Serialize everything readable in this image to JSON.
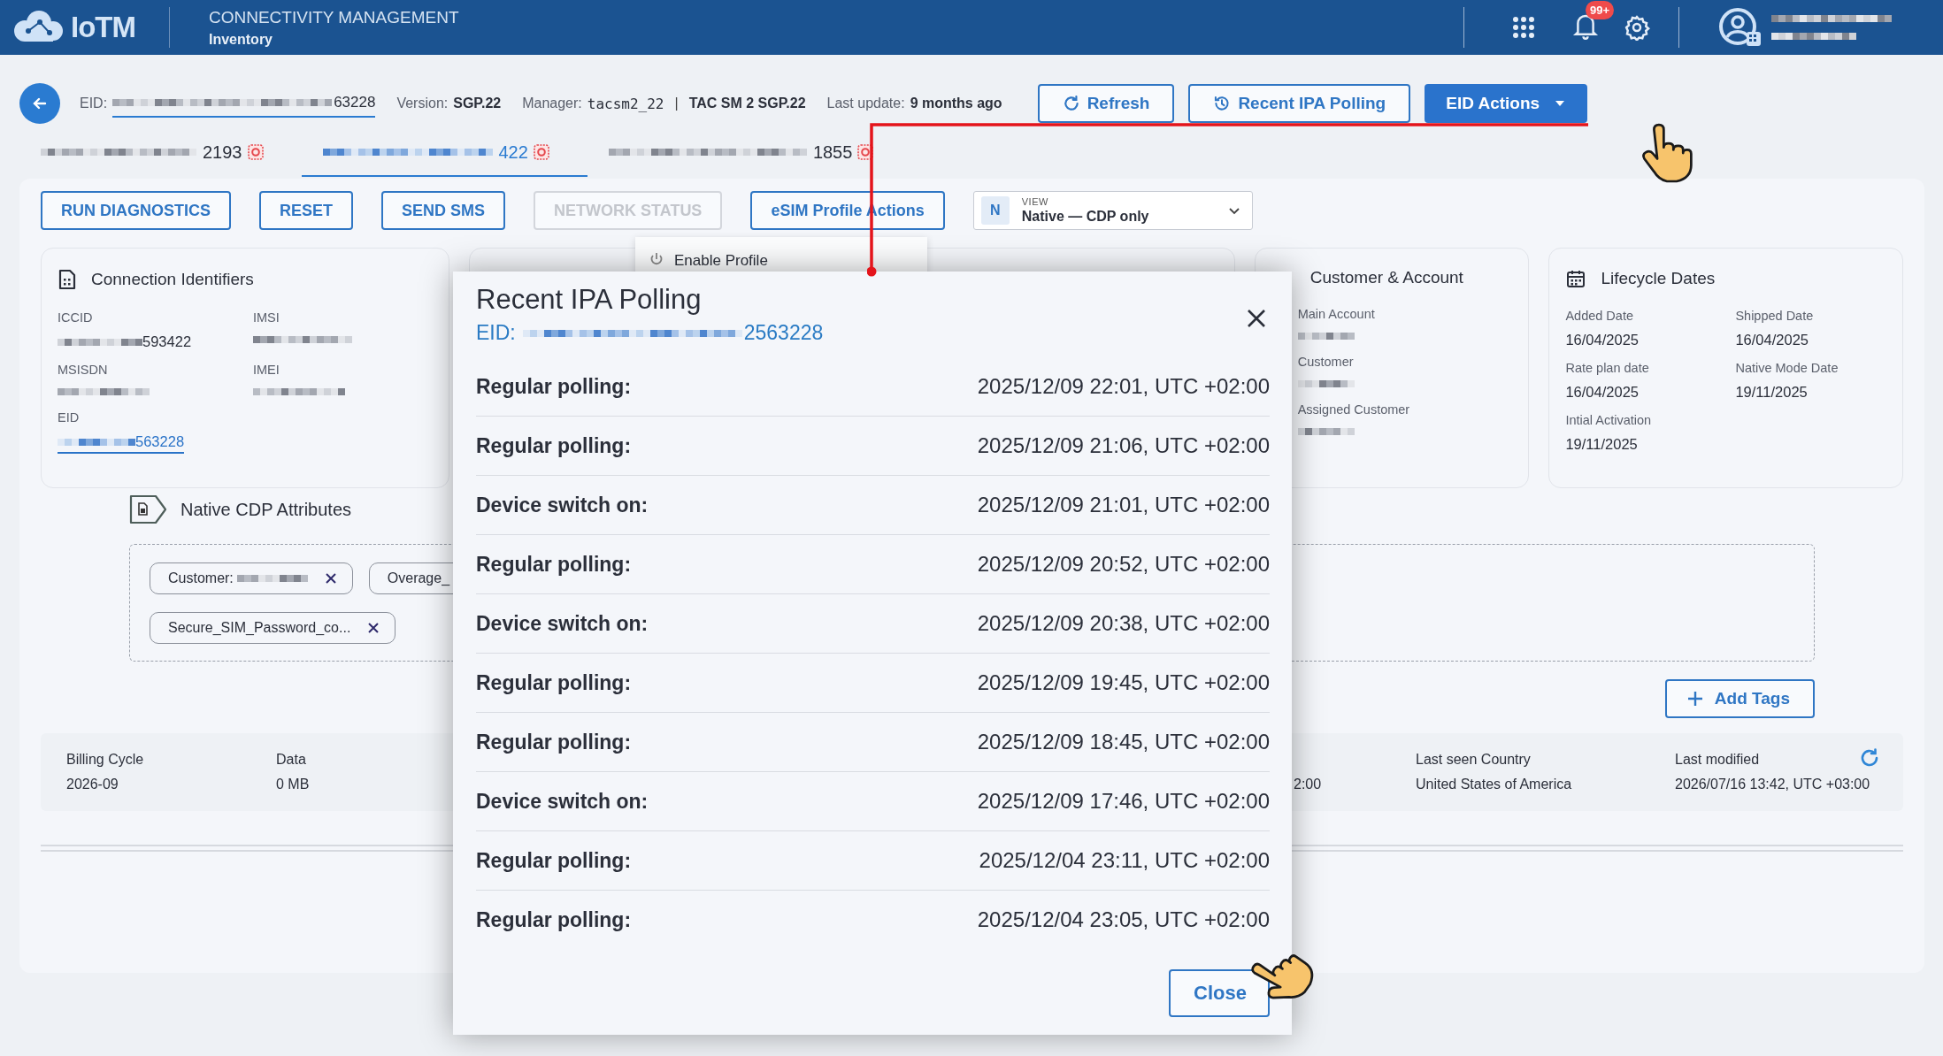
{
  "header": {
    "logo": "IoTM",
    "title": "CONNECTIVITY MANAGEMENT",
    "subtitle": "Inventory",
    "notification_badge": "99+"
  },
  "device": {
    "eid_label": "EID:",
    "eid_visible": "63228",
    "version_label": "Version:",
    "version": "SGP.22",
    "manager_label": "Manager:",
    "manager": "tacsm2_22",
    "separator": "|",
    "manager_name": "TAC SM 2 SGP.22",
    "update_label": "Last update:",
    "update": "9 months ago"
  },
  "header_buttons": [
    {
      "label": "Refresh",
      "kind": "refresh"
    },
    {
      "label": "Recent IPA Polling",
      "kind": "history"
    },
    {
      "label": "EID Actions",
      "kind": "menu"
    }
  ],
  "profile_tabs": [
    {
      "label": "2193",
      "selected": false
    },
    {
      "label": "422",
      "selected": true
    },
    {
      "label": "1855",
      "selected": false
    }
  ],
  "actions": [
    {
      "label": "RUN DIAGNOSTICS",
      "disabled": false
    },
    {
      "label": "RESET",
      "disabled": false
    },
    {
      "label": "SEND SMS",
      "disabled": false
    },
    {
      "label": "NETWORK STATUS",
      "disabled": true
    },
    {
      "label": "eSIM Profile Actions",
      "disabled": false
    }
  ],
  "view_select": {
    "badge": "N",
    "label": "VIEW",
    "value": "Native — CDP only"
  },
  "profile_menu": {
    "items": [
      "Enable Profile"
    ]
  },
  "connection_identifiers": {
    "title": "Connection Identifiers",
    "fields": [
      {
        "label": "ICCID",
        "value": "593422"
      },
      {
        "label": "IMSI"
      },
      {
        "label": "MSISDN"
      },
      {
        "label": "IMEI"
      },
      {
        "label": "EID",
        "value": "563228",
        "kind": "link"
      }
    ]
  },
  "customer_account": {
    "title": "Customer & Account",
    "fields": [
      {
        "label": "Main Account"
      },
      {
        "label": "Customer"
      },
      {
        "label": "Assigned Customer"
      }
    ]
  },
  "lifecycle": {
    "title": "Lifecycle Dates",
    "fields": [
      {
        "label": "Added Date",
        "value": "16/04/2025"
      },
      {
        "label": "Shipped Date",
        "value": "16/04/2025"
      },
      {
        "label": "Rate plan date",
        "value": "16/04/2025"
      },
      {
        "label": "Native Mode Date",
        "value": "19/11/2025"
      },
      {
        "label": "Intial Activation",
        "value": "19/11/2025"
      }
    ]
  },
  "cdp": {
    "title": "Native CDP Attributes",
    "tag_rows": [
      [
        {
          "label": "Customer:",
          "masked": true,
          "removable": true
        },
        {
          "label": "Overage_",
          "masked": false,
          "removable": false
        }
      ],
      [
        {
          "label": "Secure_SIM_Password_co...",
          "masked": false,
          "removable": true
        }
      ]
    ],
    "add_button": "Add Tags"
  },
  "summary": [
    {
      "label": "Billing Cycle",
      "value": "2026-09"
    },
    {
      "label": "Data",
      "value": "0 MB"
    },
    {
      "value": "2:00"
    },
    {
      "label": "Last seen Country",
      "value": "United States of America"
    },
    {
      "label": "Last modified",
      "value": "2026/07/16 13:42, UTC +03:00"
    }
  ],
  "modal": {
    "title": "Recent IPA Polling",
    "eid_label": "EID:",
    "eid_visible": "2563228",
    "close": "Close",
    "events": [
      {
        "label": "Regular polling:",
        "time": "2025/12/09 22:01, UTC +02:00"
      },
      {
        "label": "Regular polling:",
        "time": "2025/12/09 21:06, UTC +02:00"
      },
      {
        "label": "Device switch on:",
        "time": "2025/12/09 21:01, UTC +02:00"
      },
      {
        "label": "Regular polling:",
        "time": "2025/12/09 20:52, UTC +02:00"
      },
      {
        "label": "Device switch on:",
        "time": "2025/12/09 20:38, UTC +02:00"
      },
      {
        "label": "Regular polling:",
        "time": "2025/12/09 19:45, UTC +02:00"
      },
      {
        "label": "Regular polling:",
        "time": "2025/12/09 18:45, UTC +02:00"
      },
      {
        "label": "Device switch on:",
        "time": "2025/12/09 17:46, UTC +02:00"
      },
      {
        "label": "Regular polling:",
        "time": "2025/12/04 23:11, UTC +02:00"
      },
      {
        "label": "Regular polling:",
        "time": "2025/12/04 23:05, UTC +02:00"
      }
    ]
  }
}
